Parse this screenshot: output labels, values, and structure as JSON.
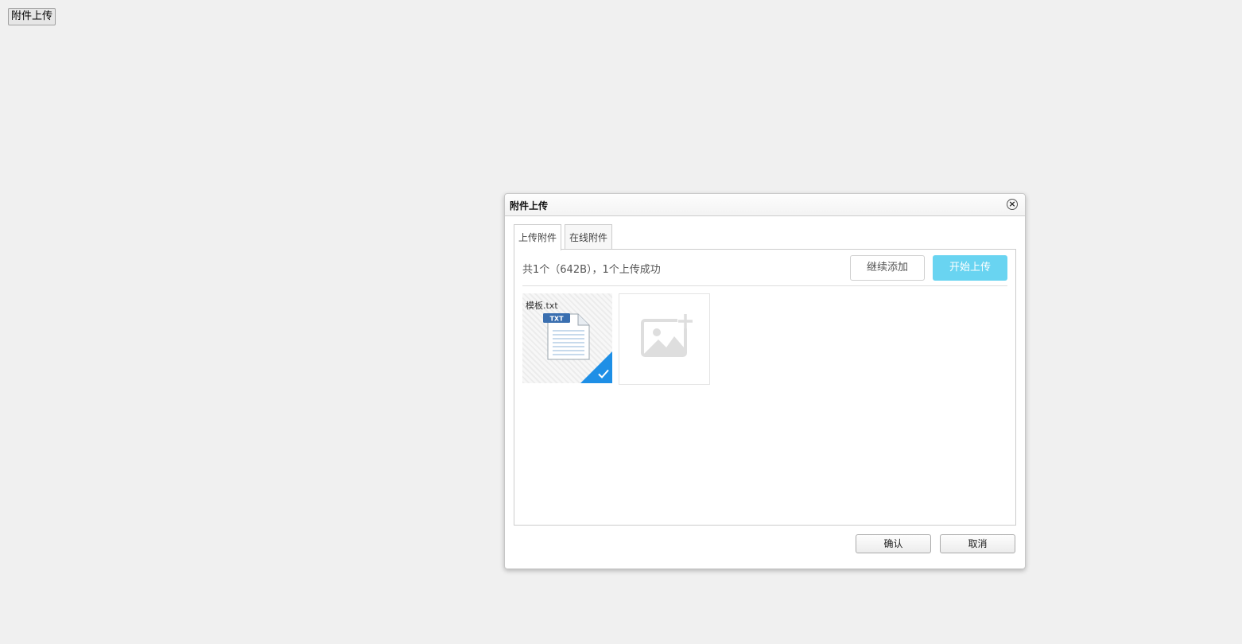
{
  "page": {
    "open_button_label": "附件上传"
  },
  "dialog": {
    "title": "附件上传",
    "close_symbol": "×",
    "tabs": [
      {
        "label": "上传附件",
        "active": true
      },
      {
        "label": "在线附件",
        "active": false
      }
    ],
    "upload": {
      "status_text": "共1个（642B），1个上传成功",
      "continue_label": "继续添加",
      "start_label": "开始上传",
      "files": [
        {
          "name": "模板.txt",
          "icon": "txt-file-icon",
          "badge": "TXT",
          "state": "uploaded",
          "state_icon": "checkmark-icon"
        }
      ],
      "add_tile_icon": "add-image-icon"
    },
    "footer": {
      "confirm_label": "确认",
      "cancel_label": "取消"
    }
  },
  "colors": {
    "start_button": "#69d4f1",
    "success_corner": "#1e8fe6",
    "page_background": "#f0f0f0"
  }
}
